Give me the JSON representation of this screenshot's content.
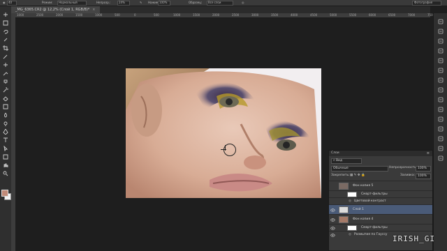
{
  "options_bar": {
    "size": "40",
    "mode": "Режим:",
    "mode_value": "Нормальный",
    "opacity_label": "Непрозр.:",
    "opacity_value": "24%",
    "flow_label": "Нажим:",
    "flow_value": "100%",
    "sample_label": "Образец:",
    "sample_value": "Все слои",
    "workspace": "Фотография"
  },
  "document_tab": {
    "title": "_MG_6365.CR2 @ 12,2% (Слой 1, RGB/8)",
    "modified": "*",
    "close": "×"
  },
  "ruler": {
    "ticks": [
      "1000",
      "2500",
      "2000",
      "1500",
      "1000",
      "500",
      "0",
      "500",
      "1000",
      "1500",
      "2000",
      "2500",
      "3000",
      "3500",
      "4000",
      "4500",
      "5000",
      "5500",
      "6000",
      "6500",
      "7000",
      "7500"
    ]
  },
  "tools": [
    "move-icon",
    "marquee-icon",
    "lasso-icon",
    "quick-select-icon",
    "crop-icon",
    "eyedropper-icon",
    "healing-brush-icon",
    "brush-icon",
    "clone-stamp-icon",
    "history-brush-icon",
    "eraser-icon",
    "gradient-icon",
    "blur-icon",
    "dodge-icon",
    "pen-icon",
    "type-icon",
    "path-select-icon",
    "shape-icon",
    "hand-icon",
    "zoom-icon"
  ],
  "colors": {
    "foreground": "#c08a78",
    "background": "#f2f2f2"
  },
  "layers_panel": {
    "tab": "Слои",
    "filter_label": "Вид",
    "blend_mode": "Обычные",
    "opacity_label": "Непрозрачность:",
    "opacity_value": "100%",
    "lock_label": "Закрепить:",
    "fill_label": "Заливка:",
    "fill_value": "100%",
    "layers": [
      {
        "name": "Фон копия 5",
        "kind": "layer",
        "visible": false,
        "selected": false
      },
      {
        "name": "Смарт-фильтры",
        "kind": "smart-filters",
        "visible": false,
        "selected": false
      },
      {
        "name": "Цветовой контраст",
        "kind": "filter",
        "visible": false,
        "selected": false
      },
      {
        "name": "Слой 1",
        "kind": "layer",
        "visible": true,
        "selected": true
      },
      {
        "name": "Фон копия 4",
        "kind": "layer",
        "visible": true,
        "selected": false
      },
      {
        "name": "Смарт-фильтры",
        "kind": "smart-filters",
        "visible": true,
        "selected": false
      },
      {
        "name": "Размытие по Гауссу",
        "kind": "filter",
        "visible": true,
        "selected": false
      }
    ]
  },
  "watermark": "IRISH_GI"
}
